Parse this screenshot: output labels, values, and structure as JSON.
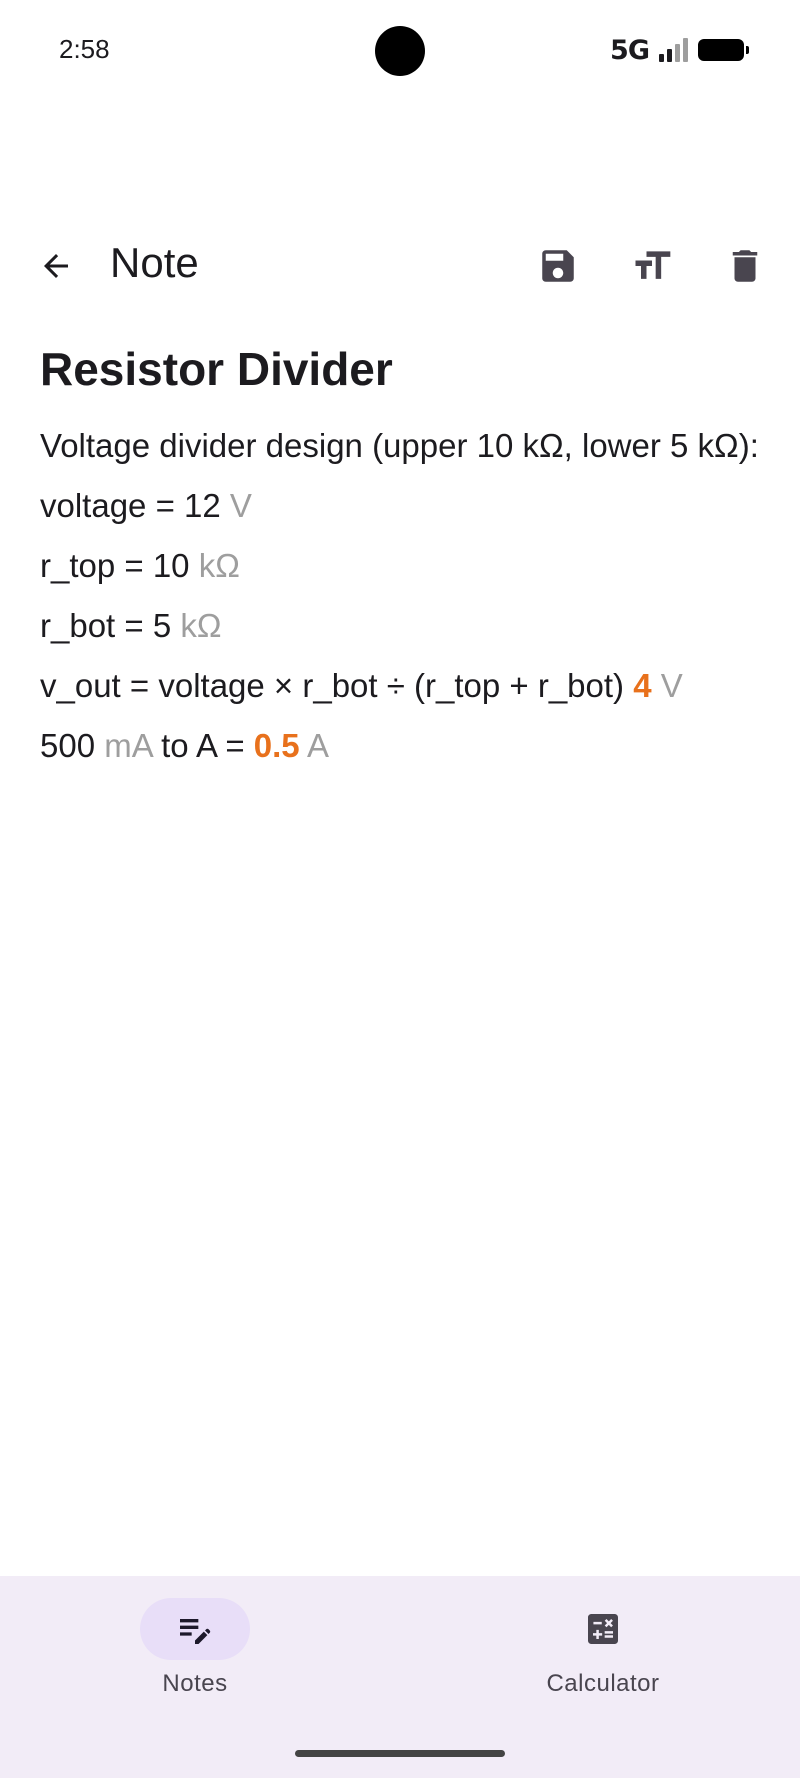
{
  "status_bar": {
    "time": "2:58",
    "network": "5G"
  },
  "app_bar": {
    "title": "Note",
    "back_icon": "arrow-back-icon",
    "actions": [
      {
        "name": "save",
        "icon": "save-icon"
      },
      {
        "name": "text-format",
        "icon": "text-size-icon"
      },
      {
        "name": "delete",
        "icon": "trash-icon"
      }
    ]
  },
  "note": {
    "title": "Resistor Divider",
    "lines": {
      "description": "Voltage divider design (upper 10 kΩ, lower 5 kΩ):",
      "voltage_expr": "voltage = 12",
      "voltage_unit": "V",
      "rtop_expr": "r_top = 10",
      "rtop_unit": "kΩ",
      "rbot_expr": "r_bot = 5",
      "rbot_unit": "kΩ",
      "vout_expr": "v_out = voltage × r_bot ÷ (r_top + r_bot)",
      "vout_result": "4",
      "vout_unit": "V",
      "conv_value": "500",
      "conv_from_unit": "mA",
      "conv_mid": "to A =",
      "conv_result": "0.5",
      "conv_to_unit": "A"
    }
  },
  "bottom_nav": {
    "items": [
      {
        "label": "Notes",
        "icon": "notes-edit-icon",
        "selected": true
      },
      {
        "label": "Calculator",
        "icon": "calculator-icon",
        "selected": false
      }
    ]
  },
  "colors": {
    "result": "#e8711c",
    "unit": "#9e9e9e",
    "nav_background": "#f2ecf7",
    "nav_selected_pill": "#e8def8"
  }
}
